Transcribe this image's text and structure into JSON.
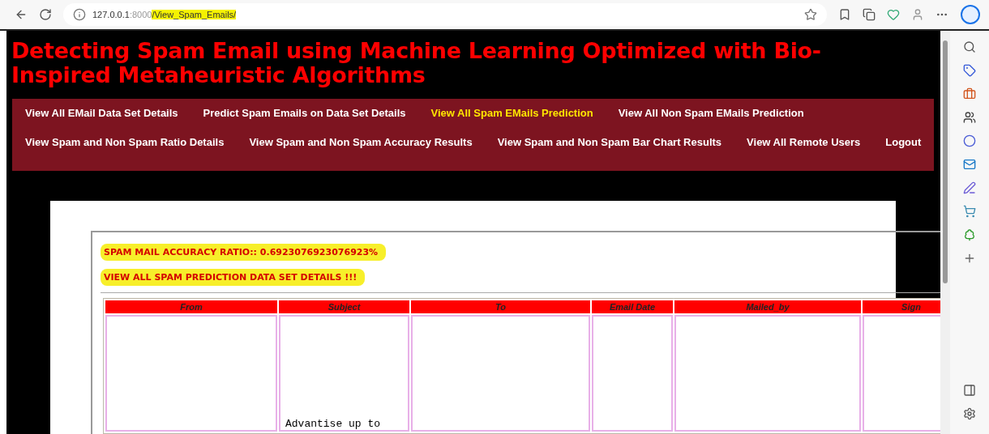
{
  "browser": {
    "url_host": "127.0.0.1",
    "url_port": ":8000",
    "url_path": "/View_Spam_Emails/"
  },
  "page": {
    "title": "Detecting Spam Email using Machine Learning Optimized with Bio-Inspired Metaheuristic Algorithms",
    "nav": [
      {
        "label": "View All EMail Data Set Details",
        "selected": false
      },
      {
        "label": "Predict Spam Emails on Data Set Details",
        "selected": false
      },
      {
        "label": "View All Spam EMails Prediction",
        "selected": true
      },
      {
        "label": "View All Non Spam EMails Prediction",
        "selected": false
      },
      {
        "label": "View Spam and Non Spam Ratio Details",
        "selected": false
      },
      {
        "label": "View Spam and Non Spam Accuracy Results",
        "selected": false
      },
      {
        "label": "View Spam and Non Spam Bar Chart Results",
        "selected": false
      },
      {
        "label": "View All Remote Users",
        "selected": false
      },
      {
        "label": "Logout",
        "selected": false
      }
    ],
    "accuracy": "SPAM MAIL ACCURACY RATIO:: 0.6923076923076923%",
    "heading": "VIEW ALL SPAM PREDICTION DATA SET DETAILS !!!",
    "table": {
      "columns": [
        "From",
        "Subject",
        "To",
        "Email Date",
        "Mailed_by",
        "Sign"
      ],
      "rows": [
        {
          "cells": [
            null,
            "Advantise up to",
            null,
            null,
            null,
            null
          ]
        }
      ]
    }
  }
}
